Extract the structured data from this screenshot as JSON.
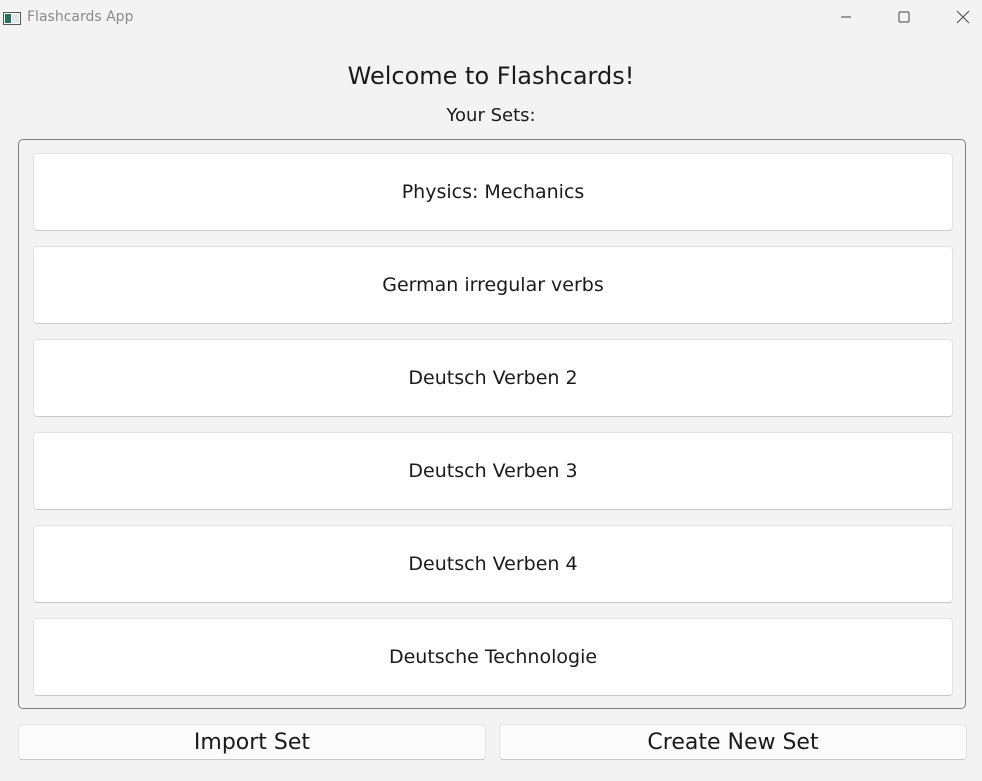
{
  "window": {
    "title": "Flashcards App",
    "icon": "app-icon",
    "controls": [
      "minimize-icon",
      "maximize-icon",
      "close-icon"
    ]
  },
  "main": {
    "heading": "Welcome to Flashcards!",
    "subheading": "Your Sets:"
  },
  "sets": [
    {
      "label": "Physics: Mechanics"
    },
    {
      "label": "German irregular verbs"
    },
    {
      "label": "Deutsch Verben 2"
    },
    {
      "label": "Deutsch Verben 3"
    },
    {
      "label": "Deutsch Verben 4"
    },
    {
      "label": "Deutsche Technologie"
    }
  ],
  "actions": {
    "import_label": "Import Set",
    "create_label": "Create New Set"
  },
  "colors": {
    "background": "#f3f3f3",
    "card": "#ffffff",
    "text": "#1a1a1a",
    "title_text": "#8a8a8a",
    "list_border": "#7a7a7a"
  }
}
